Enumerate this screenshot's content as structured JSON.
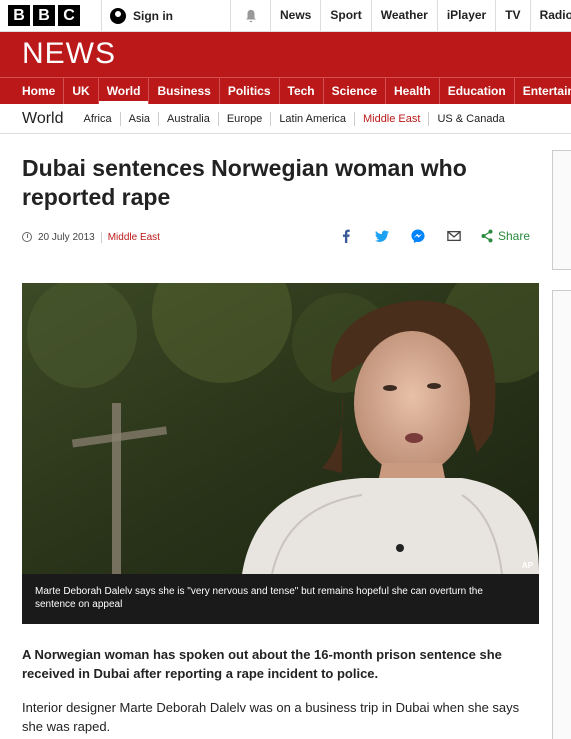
{
  "topbar": {
    "logo_letters": [
      "B",
      "B",
      "C"
    ],
    "signin_label": "Sign in",
    "nav": [
      "News",
      "Sport",
      "Weather",
      "iPlayer",
      "TV",
      "Radio"
    ]
  },
  "banner": {
    "title": "NEWS"
  },
  "main_nav": {
    "items": [
      "Home",
      "UK",
      "World",
      "Business",
      "Politics",
      "Tech",
      "Science",
      "Health",
      "Education",
      "Entertainment & Arts"
    ],
    "active": "World"
  },
  "sub_nav": {
    "section": "World",
    "items": [
      "Africa",
      "Asia",
      "Australia",
      "Europe",
      "Latin America",
      "Middle East",
      "US & Canada"
    ],
    "active": "Middle East"
  },
  "article": {
    "headline": "Dubai sentences Norwegian woman who reported rape",
    "date": "20 July 2013",
    "category": "Middle East",
    "share_label": "Share",
    "image_credit": "AP",
    "caption": "Marte Deborah Dalelv says she is \"very nervous and tense\" but remains hopeful she can overturn the sentence on appeal",
    "lead": "A Norwegian woman has spoken out about the 16-month prison sentence she received in Dubai after reporting a rape incident to police.",
    "paragraph_1": "Interior designer Marte Deborah Dalelv was on a business trip in Dubai when she says she was raped."
  },
  "colors": {
    "brand_red": "#bb1919",
    "share_green": "#2a8a3e",
    "facebook": "#3b5998",
    "twitter": "#1da1f2",
    "messenger": "#0084ff"
  }
}
